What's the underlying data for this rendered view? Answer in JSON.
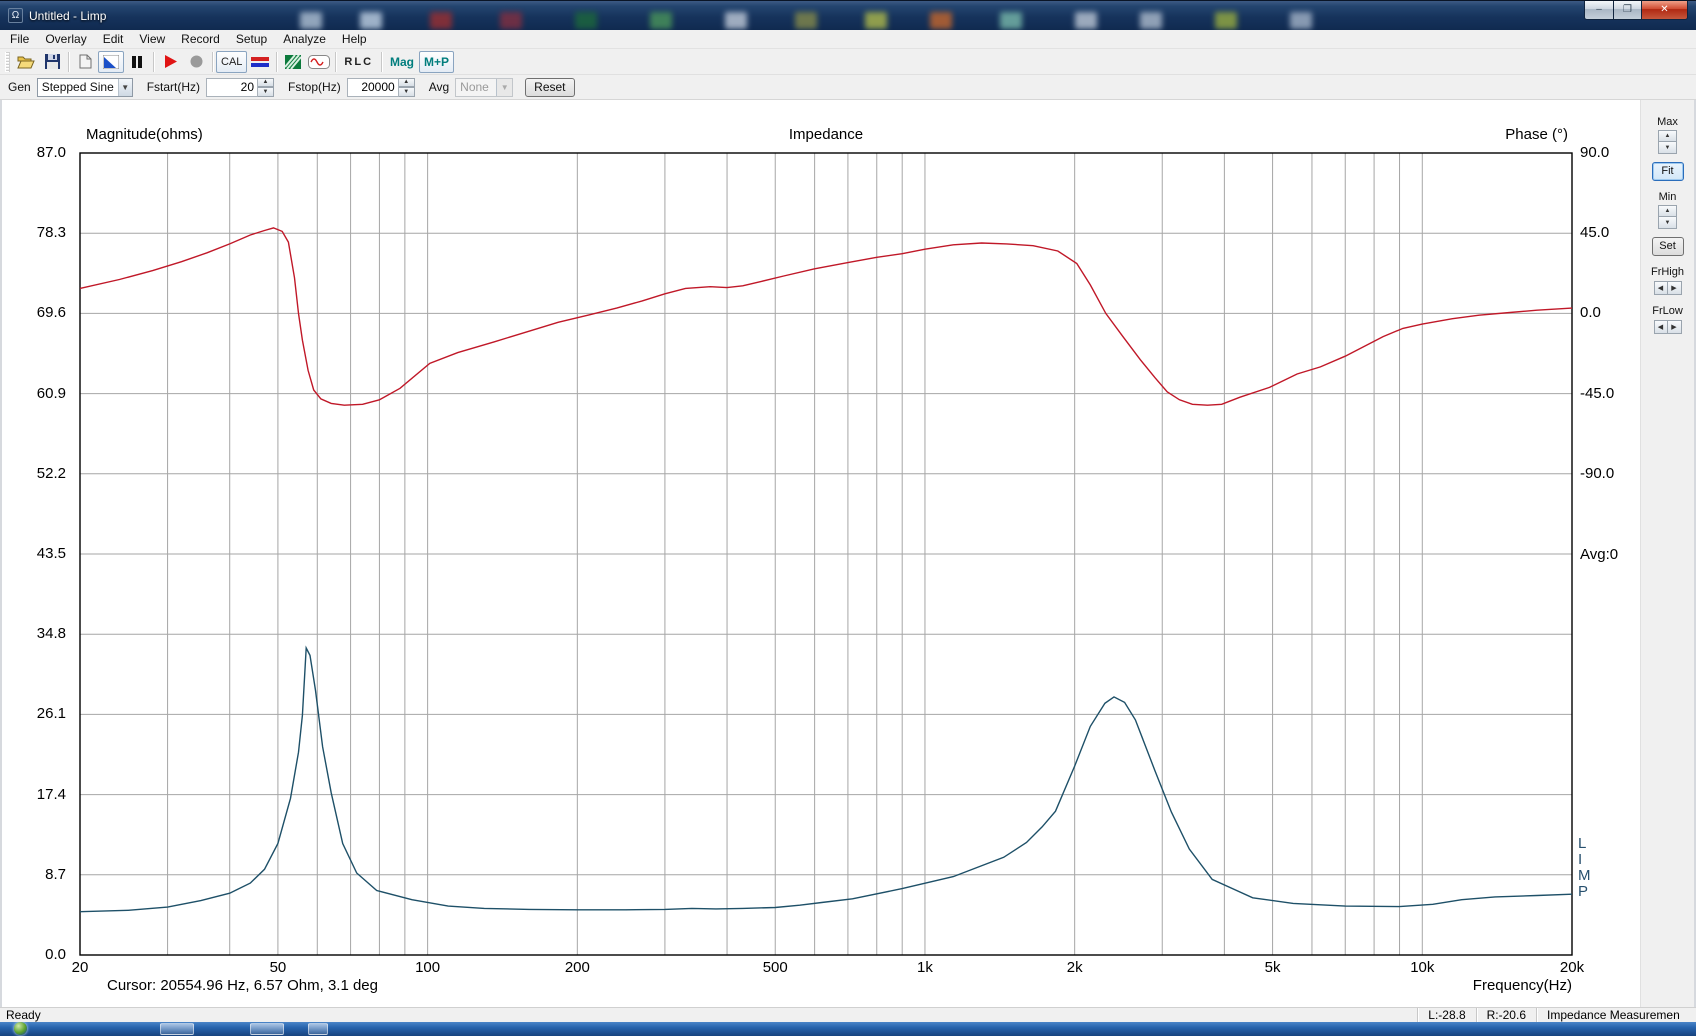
{
  "window": {
    "title": "Untitled - Limp"
  },
  "menu": {
    "items": [
      "File",
      "Overlay",
      "Edit",
      "View",
      "Record",
      "Setup",
      "Analyze",
      "Help"
    ]
  },
  "toolbar": {
    "cal_label": "CAL",
    "rlc_label": "RLC",
    "mag_label": "Mag",
    "mp_label": "M+P"
  },
  "gen_bar": {
    "gen_label": "Gen",
    "gen_value": "Stepped Sine",
    "fstart_label": "Fstart(Hz)",
    "fstart_value": "20",
    "fstop_label": "Fstop(Hz)",
    "fstop_value": "20000",
    "avg_label": "Avg",
    "avg_value": "None",
    "reset_label": "Reset"
  },
  "side_panel": {
    "max_label": "Max",
    "fit_label": "Fit",
    "min_label": "Min",
    "set_label": "Set",
    "frhigh_label": "FrHigh",
    "frlow_label": "FrLow"
  },
  "status_bar": {
    "ready": "Ready",
    "left_level": "L:-28.8",
    "right_level": "R:-20.6",
    "mode": "Impedance Measuremen"
  },
  "chart_data": {
    "type": "line",
    "title": "Impedance",
    "left_axis_label": "Magnitude(ohms)",
    "right_axis_label": "Phase (°)",
    "xlabel": "Frequency(Hz)",
    "x_scale": "log",
    "xlim": [
      20,
      20000
    ],
    "x_ticks": [
      "20",
      "50",
      "100",
      "200",
      "500",
      "1k",
      "2k",
      "5k",
      "10k",
      "20k"
    ],
    "x_tick_values": [
      20,
      50,
      100,
      200,
      500,
      1000,
      2000,
      5000,
      10000,
      20000
    ],
    "minor_grid_freqs": [
      30,
      40,
      50,
      60,
      70,
      80,
      90,
      100,
      200,
      300,
      400,
      500,
      600,
      700,
      800,
      900,
      1000,
      2000,
      3000,
      4000,
      5000,
      6000,
      7000,
      8000,
      9000,
      10000
    ],
    "left_ticks": [
      "87.0",
      "78.3",
      "69.6",
      "60.9",
      "52.2",
      "43.5",
      "34.8",
      "26.1",
      "17.4",
      "8.7",
      "0.0"
    ],
    "left_range": [
      0,
      87
    ],
    "right_ticks": [
      "90.0",
      "45.0",
      "0.0",
      "-45.0",
      "-90.0"
    ],
    "right_range": [
      -90,
      90
    ],
    "right_axis_span_divisions": 4,
    "divisions": 10,
    "grid": true,
    "avg_annotation": "Avg:0",
    "watermark": "L\nI\nM\nP",
    "cursor_readout": "Cursor: 20554.96 Hz, 6.57 Ohm, 3.1 deg",
    "colors": {
      "magnitude": "#1e5068",
      "phase": "#c01828",
      "grid": "#a6a6a6",
      "border": "#000000"
    },
    "series": [
      {
        "name": "magnitude",
        "axis": "left",
        "color": "#1e5068",
        "points": [
          [
            20,
            4.7
          ],
          [
            25,
            4.85
          ],
          [
            30,
            5.2
          ],
          [
            35,
            5.9
          ],
          [
            40,
            6.7
          ],
          [
            44,
            7.8
          ],
          [
            47,
            9.3
          ],
          [
            50,
            12.1
          ],
          [
            53,
            17
          ],
          [
            55,
            22
          ],
          [
            56,
            26
          ],
          [
            57,
            33.3
          ],
          [
            58,
            32.5
          ],
          [
            59.5,
            28.7
          ],
          [
            61.5,
            22.6
          ],
          [
            64,
            17.6
          ],
          [
            67.5,
            12.1
          ],
          [
            72,
            8.9
          ],
          [
            79,
            7.0
          ],
          [
            93,
            6.0
          ],
          [
            110,
            5.3
          ],
          [
            130,
            5.05
          ],
          [
            160,
            4.95
          ],
          [
            200,
            4.9
          ],
          [
            250,
            4.9
          ],
          [
            300,
            4.95
          ],
          [
            340,
            5.05
          ],
          [
            380,
            5.0
          ],
          [
            430,
            5.05
          ],
          [
            500,
            5.15
          ],
          [
            560,
            5.4
          ],
          [
            620,
            5.7
          ],
          [
            715,
            6.1
          ],
          [
            900,
            7.2
          ],
          [
            1140,
            8.5
          ],
          [
            1440,
            10.6
          ],
          [
            1600,
            12.2
          ],
          [
            1720,
            13.9
          ],
          [
            1830,
            15.6
          ],
          [
            2000,
            20.5
          ],
          [
            2150,
            24.8
          ],
          [
            2300,
            27.3
          ],
          [
            2400,
            28.0
          ],
          [
            2520,
            27.4
          ],
          [
            2650,
            25.5
          ],
          [
            2900,
            20
          ],
          [
            3130,
            15.5
          ],
          [
            3400,
            11.5
          ],
          [
            3780,
            8.2
          ],
          [
            4560,
            6.2
          ],
          [
            5500,
            5.6
          ],
          [
            7000,
            5.3
          ],
          [
            9000,
            5.25
          ],
          [
            10500,
            5.5
          ],
          [
            12000,
            6.0
          ],
          [
            14000,
            6.3
          ],
          [
            17000,
            6.45
          ],
          [
            20000,
            6.6
          ]
        ]
      },
      {
        "name": "phase",
        "axis": "right",
        "color": "#c01828",
        "points": [
          [
            20,
            14
          ],
          [
            24,
            19
          ],
          [
            28,
            24
          ],
          [
            32,
            29
          ],
          [
            36,
            34
          ],
          [
            40,
            39
          ],
          [
            44,
            44
          ],
          [
            47,
            46.5
          ],
          [
            49,
            48
          ],
          [
            51,
            46
          ],
          [
            52.5,
            40
          ],
          [
            54,
            20
          ],
          [
            55,
            0
          ],
          [
            56,
            -15
          ],
          [
            57.5,
            -32
          ],
          [
            59,
            -43
          ],
          [
            61,
            -48
          ],
          [
            64,
            -50.5
          ],
          [
            68,
            -51.5
          ],
          [
            74,
            -51
          ],
          [
            80,
            -48.5
          ],
          [
            88,
            -42
          ],
          [
            101,
            -28
          ],
          [
            115,
            -22
          ],
          [
            136,
            -16
          ],
          [
            160,
            -10
          ],
          [
            183,
            -5
          ],
          [
            210,
            -1
          ],
          [
            240,
            3
          ],
          [
            270,
            7
          ],
          [
            300,
            11
          ],
          [
            330,
            14
          ],
          [
            370,
            15
          ],
          [
            400,
            14.5
          ],
          [
            430,
            15.5
          ],
          [
            470,
            18
          ],
          [
            520,
            21
          ],
          [
            600,
            25
          ],
          [
            700,
            28.5
          ],
          [
            800,
            31.5
          ],
          [
            900,
            33.5
          ],
          [
            1000,
            36
          ],
          [
            1140,
            38.5
          ],
          [
            1300,
            39.5
          ],
          [
            1460,
            39
          ],
          [
            1650,
            38
          ],
          [
            1850,
            35
          ],
          [
            2020,
            28
          ],
          [
            2150,
            16
          ],
          [
            2310,
            0
          ],
          [
            2500,
            -13
          ],
          [
            2710,
            -26
          ],
          [
            2900,
            -36
          ],
          [
            3070,
            -44
          ],
          [
            3250,
            -48.5
          ],
          [
            3450,
            -51
          ],
          [
            3700,
            -51.5
          ],
          [
            3950,
            -51
          ],
          [
            4300,
            -47
          ],
          [
            4930,
            -41.5
          ],
          [
            5600,
            -34
          ],
          [
            6240,
            -30
          ],
          [
            7000,
            -24
          ],
          [
            8340,
            -13
          ],
          [
            9140,
            -8.4
          ],
          [
            10000,
            -6
          ],
          [
            11500,
            -3
          ],
          [
            13000,
            -1
          ],
          [
            15000,
            0.5
          ],
          [
            17000,
            1.8
          ],
          [
            20000,
            3
          ]
        ]
      }
    ]
  }
}
